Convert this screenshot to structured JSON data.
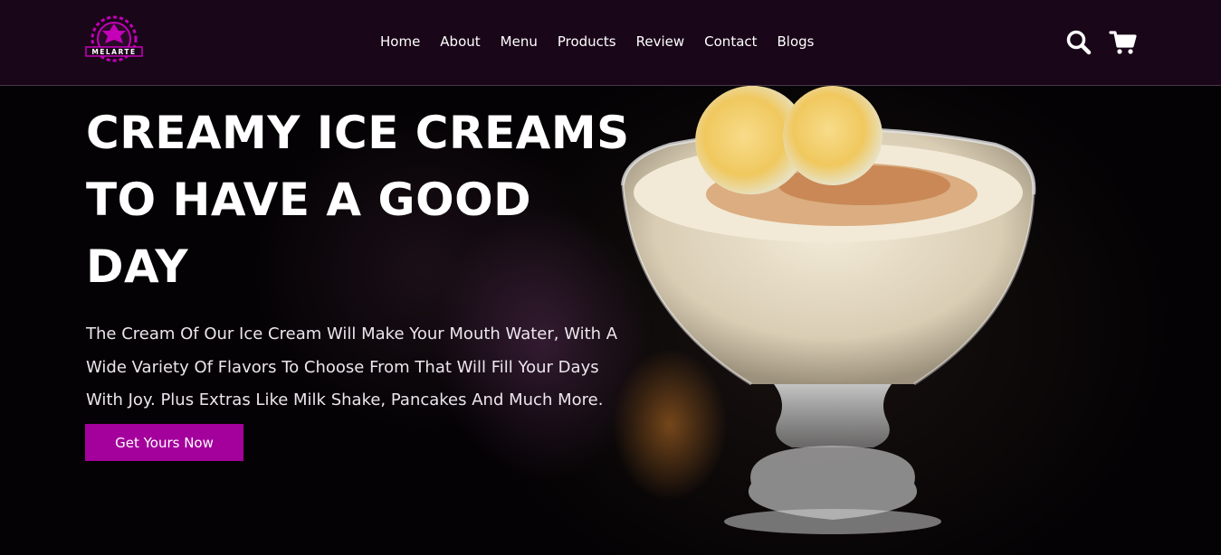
{
  "brand": {
    "logo_text": "MELARTE",
    "accent_color": "#a3009c",
    "header_bg": "#1a0619"
  },
  "nav": {
    "items": [
      {
        "label": "Home"
      },
      {
        "label": "About"
      },
      {
        "label": "Menu"
      },
      {
        "label": "Products"
      },
      {
        "label": "Review"
      },
      {
        "label": "Contact"
      },
      {
        "label": "Blogs"
      }
    ]
  },
  "header_icons": {
    "search": "search-icon",
    "cart": "cart-icon"
  },
  "hero": {
    "title": "CREAMY ICE CREAMS\nTO HAVE A GOOD\nDAY",
    "description": "The Cream Of Our Ice Cream Will Make Your Mouth Water, With A Wide Variety Of Flavors To Choose From That Will Fill Your Days With Joy. Plus Extras Like Milk Shake, Pancakes And Much More.",
    "cta_label": "Get Yours Now",
    "image": "ice-cream-dessert-with-banana-slices"
  }
}
